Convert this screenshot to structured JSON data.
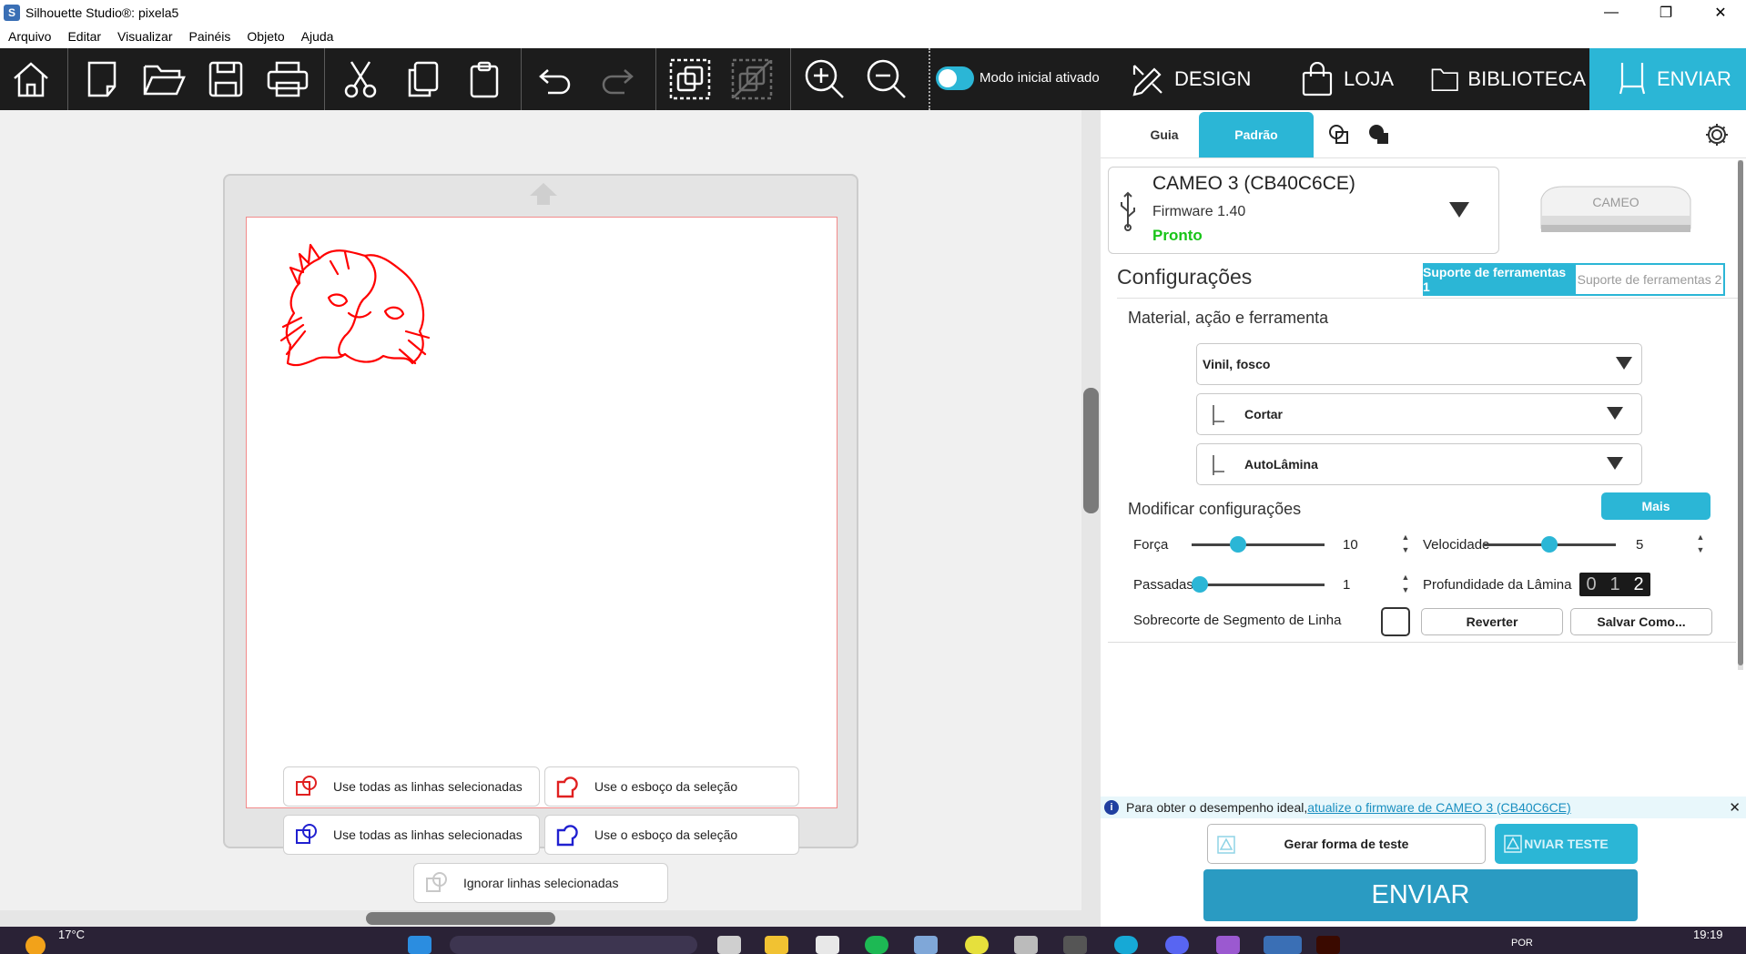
{
  "window": {
    "title": "Silhouette Studio®: pixela5"
  },
  "menu": [
    "Arquivo",
    "Editar",
    "Visualizar",
    "Painéis",
    "Objeto",
    "Ajuda"
  ],
  "toolbar": {
    "mode_label": "Modo inicial ativado",
    "tabs": {
      "design": "DESIGN",
      "store": "LOJA",
      "library": "BIBLIOTECA",
      "send": "ENVIAR"
    }
  },
  "canvas": {
    "options": {
      "red_all_lines": "Use todas as linhas selecionadas",
      "red_outline": "Use o esboço da seleção",
      "blue_all_lines": "Use todas as linhas selecionadas",
      "blue_outline": "Use o esboço da seleção",
      "ignore": "Ignorar linhas selecionadas"
    }
  },
  "panel": {
    "tabs": {
      "guide": "Guia",
      "standard": "Padrão"
    },
    "device": {
      "name": "CAMEO 3 (CB40C6CE)",
      "firmware": "Firmware 1.40",
      "status": "Pronto",
      "machine_label": "CAMEO"
    },
    "settings_title": "Configurações",
    "tool_holders": {
      "holder1": "Suporte de ferramentas 1",
      "holder2": "Suporte de ferramentas 2"
    },
    "material_title": "Material, ação e ferramenta",
    "material": "Vinil, fosco",
    "action": "Cortar",
    "tool": "AutoLâmina",
    "modify_title": "Modificar configurações",
    "more_button": "Mais",
    "force": {
      "label": "Força",
      "value": "10",
      "level": 0.33
    },
    "speed": {
      "label": "Velocidade",
      "value": "5",
      "level": 0.5
    },
    "passes": {
      "label": "Passadas",
      "value": "1",
      "level": 0.0
    },
    "blade_depth": {
      "label": "Profundidade da Lâmina",
      "values": [
        "0",
        "1",
        "2"
      ]
    },
    "overcut_label": "Sobrecorte de Segmento de Linha",
    "revert_button": "Reverter",
    "save_as_button": "Salvar Como...",
    "notice": {
      "text": "Para obter o desempenho ideal, ",
      "link": "atualize o firmware de CAMEO 3 (CB40C6CE)"
    },
    "test_shape_button": "Gerar forma de teste",
    "send_test_button": "NVIAR TESTE",
    "send_button": "ENVIAR"
  },
  "taskbar": {
    "weather": "17°C",
    "time": "19:19",
    "lang": "POR"
  },
  "colors": {
    "accent": "#2bb6d6",
    "toolbar": "#1c1c1c",
    "ready": "#18c418",
    "cut_line": "#ff0000"
  }
}
